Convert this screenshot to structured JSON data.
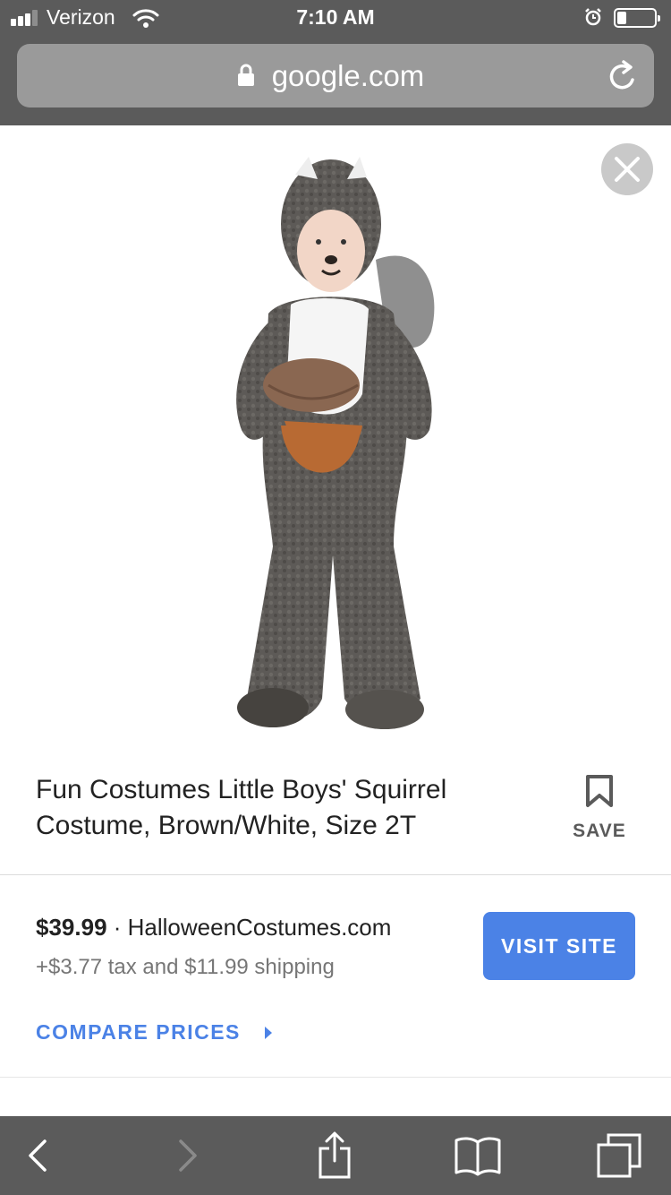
{
  "status_bar": {
    "carrier": "Verizon",
    "time": "7:10 AM",
    "battery_level": 0.25
  },
  "browser": {
    "url": "google.com"
  },
  "product": {
    "image_alt": "child in squirrel costume holding acorn",
    "title": "Fun Costumes Little Boys' Squirrel Costume, Brown/White, Size 2T",
    "save_label": "SAVE"
  },
  "offer": {
    "price": "$39.99",
    "separator": " · ",
    "merchant": "HalloweenCostumes.com",
    "tax_shipping": "+$3.77 tax and $11.99 shipping",
    "visit_label": "VISIT SITE",
    "compare_label": "COMPARE PRICES"
  },
  "colors": {
    "accent": "#4b82e6",
    "chrome": "#5b5b5b"
  },
  "toolbar": {
    "icons": [
      "back-icon",
      "forward-icon",
      "share-icon",
      "bookmarks-icon",
      "tabs-icon"
    ]
  }
}
